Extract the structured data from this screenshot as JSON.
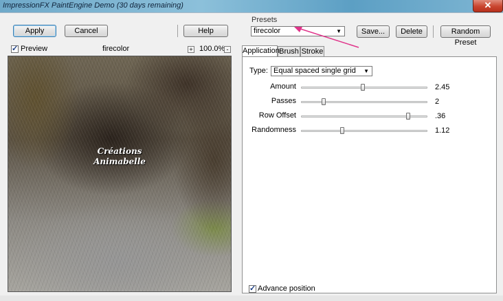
{
  "window": {
    "title": "ImpressionFX PaintEngine Demo (30 days remaining)",
    "close_glyph": "✕"
  },
  "toolbar": {
    "apply_label": "Apply",
    "cancel_label": "Cancel",
    "help_label": "Help"
  },
  "preview": {
    "checkbox_label": "Preview",
    "checked": true,
    "preset_name": "firecolor",
    "zoom_in": "+",
    "zoom_out": "-",
    "zoom_level": "100.0%",
    "watermark_line1": "Créations",
    "watermark_line2": "Animabelle"
  },
  "presets": {
    "group_label": "Presets",
    "selected": "firecolor",
    "save_label": "Save...",
    "delete_label": "Delete",
    "random_label": "Random Preset"
  },
  "tabs": [
    {
      "label": "Application",
      "active": true
    },
    {
      "label": "Brush",
      "active": false
    },
    {
      "label": "Stroke",
      "active": false
    }
  ],
  "application": {
    "type_label": "Type:",
    "type_value": "Equal spaced single grid",
    "sliders": [
      {
        "label": "Amount",
        "value": "2.45",
        "fraction": 0.49
      },
      {
        "label": "Passes",
        "value": "2",
        "fraction": 0.17
      },
      {
        "label": "Row Offset",
        "value": ".36",
        "fraction": 0.86
      },
      {
        "label": "Randomness",
        "value": "1.12",
        "fraction": 0.32
      }
    ],
    "advance_label": "Advance position",
    "advance_checked": true
  },
  "colors": {
    "annotation_arrow": "#e0338a",
    "default_button_border": "#3c7fb1"
  }
}
